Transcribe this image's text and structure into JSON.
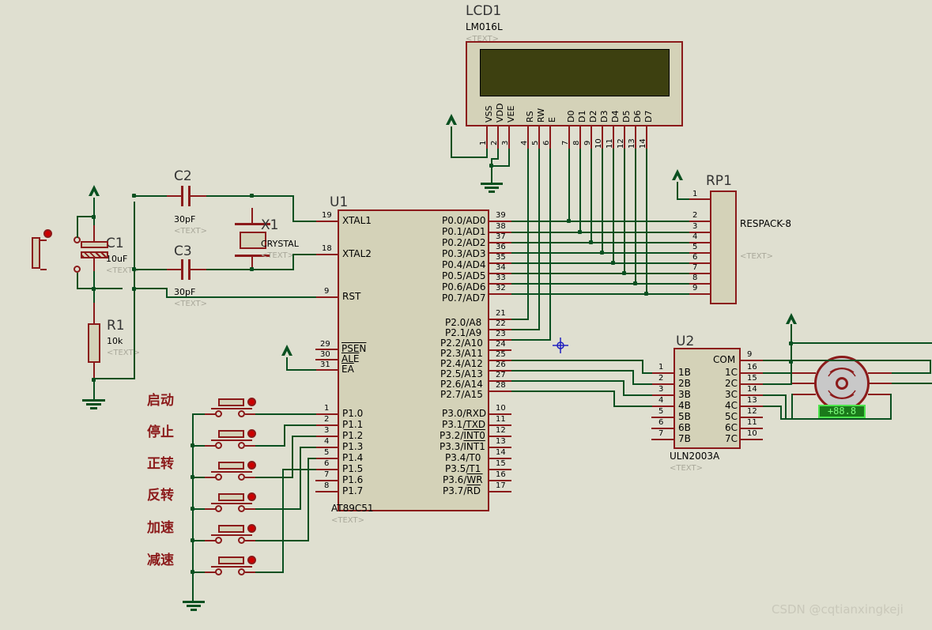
{
  "app": {
    "kind": "proteus-schematic",
    "watermark": "CSDN @cqtianxingkeji",
    "background_color": "#dfdfd0",
    "wire_color": "#0a5020",
    "pin_color": "#8b1a1a",
    "body_fill": "#d4d2b8",
    "cursor_color": "#2020c0"
  },
  "lcd": {
    "ref": "LCD1",
    "part": "LM016L",
    "text": "<TEXT>",
    "screen_color": "#3d4010",
    "pin_labels": [
      "VSS",
      "VDD",
      "VEE",
      "RS",
      "RW",
      "E",
      "D0",
      "D1",
      "D2",
      "D3",
      "D4",
      "D5",
      "D6",
      "D7"
    ],
    "pin_numbers": [
      "1",
      "2",
      "3",
      "4",
      "5",
      "6",
      "7",
      "8",
      "9",
      "10",
      "11",
      "12",
      "13",
      "14"
    ]
  },
  "mcu": {
    "ref": "U1",
    "part": "AT89C51",
    "text": "<TEXT>",
    "left_pins": [
      {
        "num": "19",
        "label": "XTAL1"
      },
      {
        "num": "18",
        "label": "XTAL2"
      },
      {
        "num": "9",
        "label": "RST"
      },
      {
        "num": "29",
        "label": "PSEN",
        "overline": true
      },
      {
        "num": "30",
        "label": "ALE",
        "overline": true
      },
      {
        "num": "31",
        "label": "EA",
        "overline": true
      },
      {
        "num": "1",
        "label": "P1.0"
      },
      {
        "num": "2",
        "label": "P1.1"
      },
      {
        "num": "3",
        "label": "P1.2"
      },
      {
        "num": "4",
        "label": "P1.3"
      },
      {
        "num": "5",
        "label": "P1.4"
      },
      {
        "num": "6",
        "label": "P1.5"
      },
      {
        "num": "7",
        "label": "P1.6"
      },
      {
        "num": "8",
        "label": "P1.7"
      }
    ],
    "right_pins_p0": [
      {
        "num": "39",
        "label": "P0.0/AD0"
      },
      {
        "num": "38",
        "label": "P0.1/AD1"
      },
      {
        "num": "37",
        "label": "P0.2/AD2"
      },
      {
        "num": "36",
        "label": "P0.3/AD3"
      },
      {
        "num": "35",
        "label": "P0.4/AD4"
      },
      {
        "num": "34",
        "label": "P0.5/AD5"
      },
      {
        "num": "33",
        "label": "P0.6/AD6"
      },
      {
        "num": "32",
        "label": "P0.7/AD7"
      }
    ],
    "right_pins_p2": [
      {
        "num": "21",
        "label": "P2.0/A8"
      },
      {
        "num": "22",
        "label": "P2.1/A9"
      },
      {
        "num": "23",
        "label": "P2.2/A10"
      },
      {
        "num": "24",
        "label": "P2.3/A11"
      },
      {
        "num": "25",
        "label": "P2.4/A12"
      },
      {
        "num": "26",
        "label": "P2.5/A13"
      },
      {
        "num": "27",
        "label": "P2.6/A14"
      },
      {
        "num": "28",
        "label": "P2.7/A15"
      }
    ],
    "right_pins_p3": [
      {
        "num": "10",
        "label": "P3.0/RXD"
      },
      {
        "num": "11",
        "label": "P3.1/TXD"
      },
      {
        "num": "12",
        "label": "P3.2/INT0",
        "overline_part": "INT0"
      },
      {
        "num": "13",
        "label": "P3.3/INT1",
        "overline_part": "INT1"
      },
      {
        "num": "14",
        "label": "P3.4/T0"
      },
      {
        "num": "15",
        "label": "P3.5/T1"
      },
      {
        "num": "16",
        "label": "P3.6/WR",
        "overline_part": "WR"
      },
      {
        "num": "17",
        "label": "P3.7/RD",
        "overline_part": "RD"
      }
    ]
  },
  "respack": {
    "ref": "RP1",
    "part": "RESPACK-8",
    "text": "<TEXT>",
    "pin_numbers": [
      "1",
      "2",
      "3",
      "4",
      "5",
      "6",
      "7",
      "8",
      "9"
    ]
  },
  "uln": {
    "ref": "U2",
    "part": "ULN2003A",
    "text": "<TEXT>",
    "left_pins": [
      {
        "num": "1",
        "label": "1B"
      },
      {
        "num": "2",
        "label": "2B"
      },
      {
        "num": "3",
        "label": "3B"
      },
      {
        "num": "4",
        "label": "4B"
      },
      {
        "num": "5",
        "label": "5B"
      },
      {
        "num": "6",
        "label": "6B"
      },
      {
        "num": "7",
        "label": "7B"
      }
    ],
    "right_pins": [
      {
        "num": "9",
        "label": "COM"
      },
      {
        "num": "16",
        "label": "1C"
      },
      {
        "num": "15",
        "label": "2C"
      },
      {
        "num": "14",
        "label": "3C"
      },
      {
        "num": "13",
        "label": "4C"
      },
      {
        "num": "12",
        "label": "5C"
      },
      {
        "num": "11",
        "label": "6C"
      },
      {
        "num": "10",
        "label": "7C"
      }
    ]
  },
  "motor": {
    "name": "stepper-motor",
    "display_value": "+88.8",
    "display_bg": "#1a7a1a",
    "display_fg": "#7fff7f"
  },
  "passives": [
    {
      "ref": "C1",
      "value": "10uF",
      "text": "<TEXT>"
    },
    {
      "ref": "C2",
      "value": "30pF",
      "text": "<TEXT>"
    },
    {
      "ref": "C3",
      "value": "30pF",
      "text": "<TEXT>"
    },
    {
      "ref": "R1",
      "value": "10k",
      "text": "<TEXT>"
    },
    {
      "ref": "X1",
      "value": "CRYSTAL",
      "text": "<TEXT>"
    }
  ],
  "buttons": [
    {
      "label": "启动",
      "pin": "1"
    },
    {
      "label": "停止",
      "pin": "2"
    },
    {
      "label": "正转",
      "pin": "3"
    },
    {
      "label": "反转",
      "pin": "4"
    },
    {
      "label": "加速",
      "pin": "5"
    },
    {
      "label": "减速",
      "pin": "6"
    }
  ],
  "unused_mcu_pins": [
    "7",
    "8"
  ]
}
